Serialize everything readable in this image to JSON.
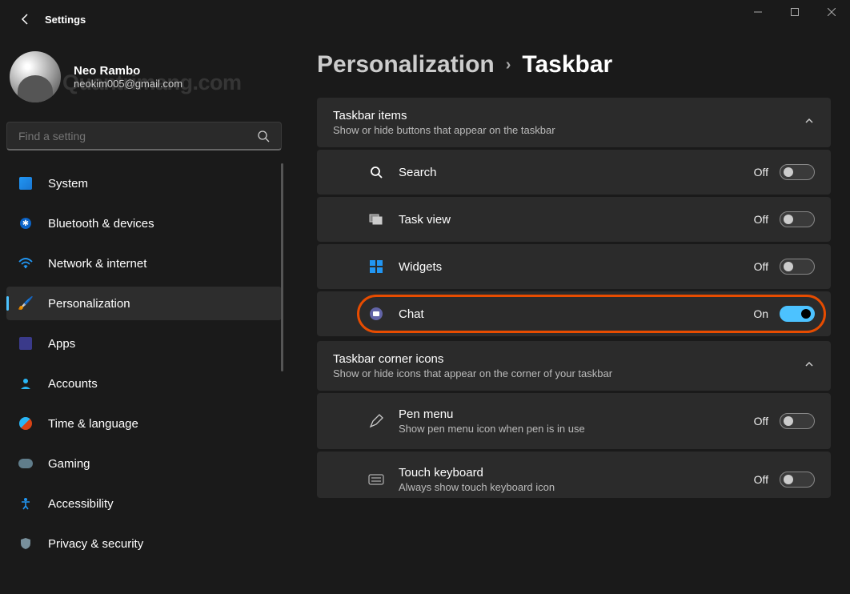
{
  "window": {
    "title": "Settings"
  },
  "profile": {
    "name": "Neo Rambo",
    "email": "neokim005@gmail.com",
    "watermark": "Quantrimang.com"
  },
  "search": {
    "placeholder": "Find a setting"
  },
  "nav": [
    {
      "id": "system",
      "label": "System",
      "active": false
    },
    {
      "id": "bluetooth",
      "label": "Bluetooth & devices",
      "active": false
    },
    {
      "id": "network",
      "label": "Network & internet",
      "active": false
    },
    {
      "id": "personalization",
      "label": "Personalization",
      "active": true
    },
    {
      "id": "apps",
      "label": "Apps",
      "active": false
    },
    {
      "id": "accounts",
      "label": "Accounts",
      "active": false
    },
    {
      "id": "time",
      "label": "Time & language",
      "active": false
    },
    {
      "id": "gaming",
      "label": "Gaming",
      "active": false
    },
    {
      "id": "accessibility",
      "label": "Accessibility",
      "active": false
    },
    {
      "id": "privacy",
      "label": "Privacy & security",
      "active": false
    }
  ],
  "breadcrumb": {
    "parent": "Personalization",
    "current": "Taskbar"
  },
  "sections": {
    "taskbar_items": {
      "title": "Taskbar items",
      "subtitle": "Show or hide buttons that appear on the taskbar",
      "rows": [
        {
          "id": "search",
          "label": "Search",
          "state": "Off",
          "on": false
        },
        {
          "id": "taskview",
          "label": "Task view",
          "state": "Off",
          "on": false
        },
        {
          "id": "widgets",
          "label": "Widgets",
          "state": "Off",
          "on": false
        },
        {
          "id": "chat",
          "label": "Chat",
          "state": "On",
          "on": true,
          "highlight": true
        }
      ]
    },
    "corner_icons": {
      "title": "Taskbar corner icons",
      "subtitle": "Show or hide icons that appear on the corner of your taskbar",
      "rows": [
        {
          "id": "pen",
          "label": "Pen menu",
          "sub": "Show pen menu icon when pen is in use",
          "state": "Off",
          "on": false
        },
        {
          "id": "touchkb",
          "label": "Touch keyboard",
          "sub": "Always show touch keyboard icon",
          "state": "Off",
          "on": false
        }
      ]
    }
  }
}
